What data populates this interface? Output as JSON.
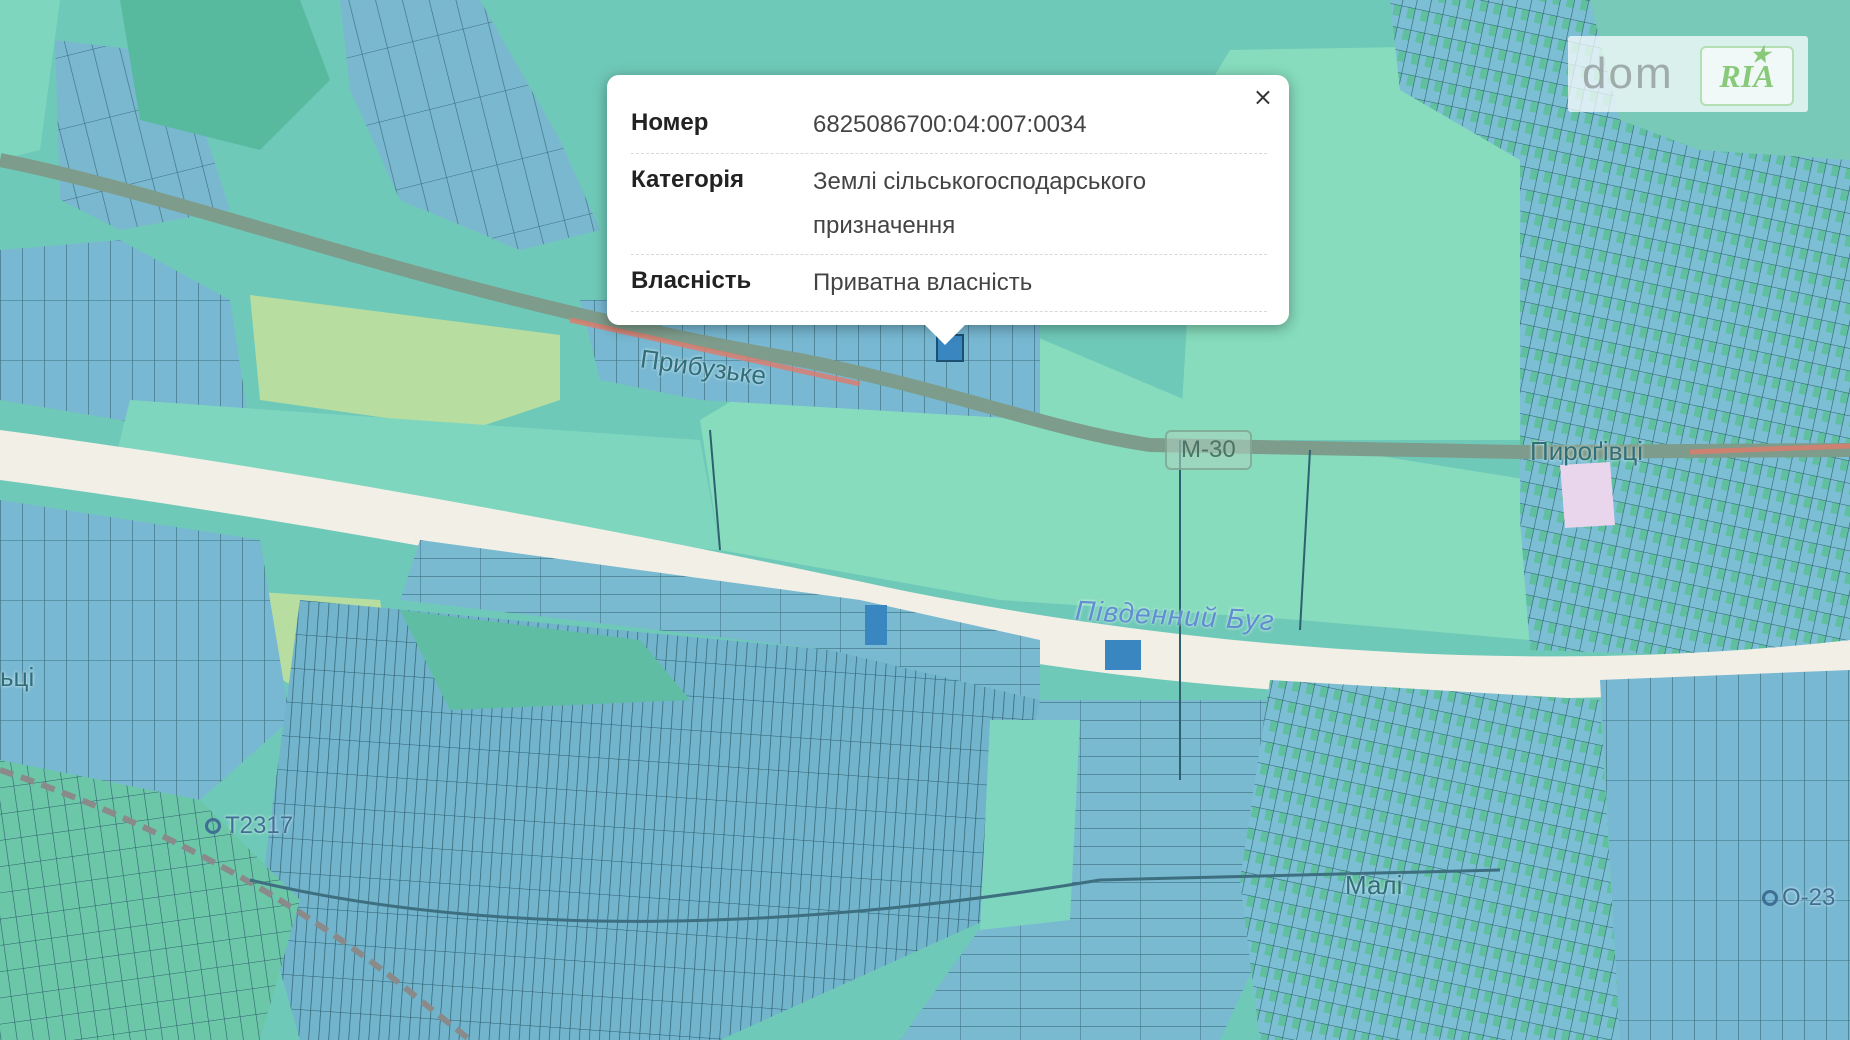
{
  "popup": {
    "close_icon": "×",
    "rows": [
      {
        "key": "Номер",
        "value": "6825086700:04:007:0034"
      },
      {
        "key": "Категорія",
        "value": "Землі сільськогосподарського призначення"
      },
      {
        "key": "Власність",
        "value": "Приватна власність"
      }
    ]
  },
  "map": {
    "place_labels": {
      "pribuzke": "Прибузьке",
      "pyrohivtsi": "Пироґівці",
      "left_edge": "ьці",
      "bottom_village": "Малі"
    },
    "river_label": "Південний Буг",
    "road_shield": "М-30",
    "road_refs": {
      "left": "Т2317",
      "right": "О-23"
    },
    "colors": {
      "agri_land": "#6fc9b8",
      "parcel": "#78b8d2",
      "parcel_stroke": "#3d6f80",
      "large_field": "#86dcbd",
      "meadow": "#b7dda0",
      "road": "#7e9c8b",
      "road_red": "#e07a6a",
      "river_corridor": "#f2efe6",
      "highlight": "#3a86c0"
    }
  },
  "watermark": {
    "dom": "dom",
    "ria": "RIA"
  }
}
